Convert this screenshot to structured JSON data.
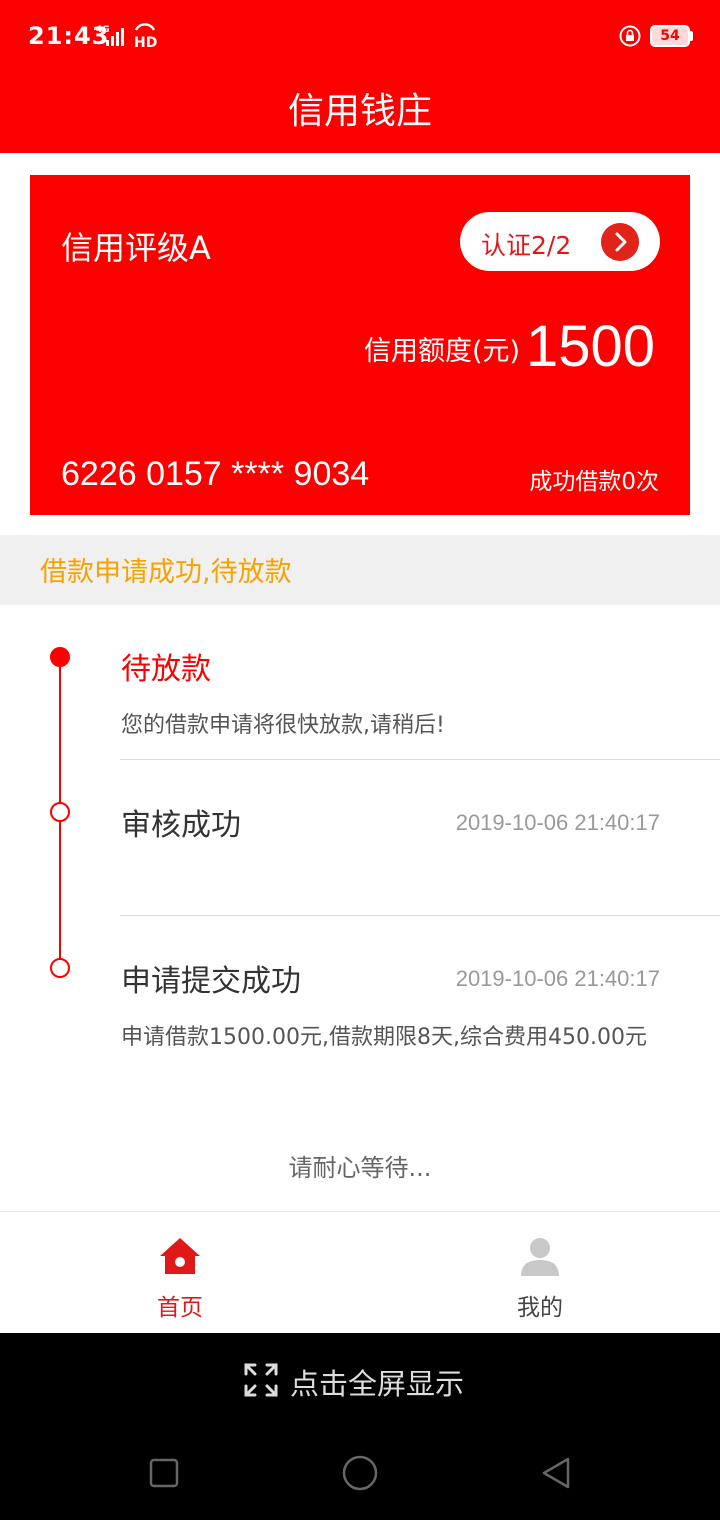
{
  "status_bar": {
    "time": "21:43",
    "network": "4G",
    "hd": "HD",
    "battery": "54"
  },
  "header": {
    "title": "信用钱庄"
  },
  "card": {
    "grade": "信用评级A",
    "certification": "认证2/2",
    "quota_label": "信用额度(元)",
    "quota_value": "1500",
    "card_number": "6226 0157 **** 9034",
    "borrow_count": "成功借款0次"
  },
  "notice": {
    "text": "借款申请成功,待放款"
  },
  "timeline": [
    {
      "title": "待放款",
      "desc": "您的借款申请将很快放款,请稍后!",
      "time": ""
    },
    {
      "title": "审核成功",
      "desc": "",
      "time": "2019-10-06 21:40:17"
    },
    {
      "title": "申请提交成功",
      "desc": "申请借款1500.00元,借款期限8天,综合费用450.00元",
      "time": "2019-10-06 21:40:17"
    }
  ],
  "wait_text": "请耐心等待...",
  "bottom_nav": {
    "home_label": "首页",
    "mine_label": "我的"
  },
  "system": {
    "fullscreen_label": "点击全屏显示"
  },
  "colors": {
    "brand_red": "#fc0000",
    "notice_orange": "#f5a300",
    "icon_gray": "#c8c8c8"
  },
  "icons": {
    "cert_arrow": "chevron-right-icon",
    "home": "home-icon",
    "mine": "user-icon",
    "fullscreen": "expand-icon"
  }
}
